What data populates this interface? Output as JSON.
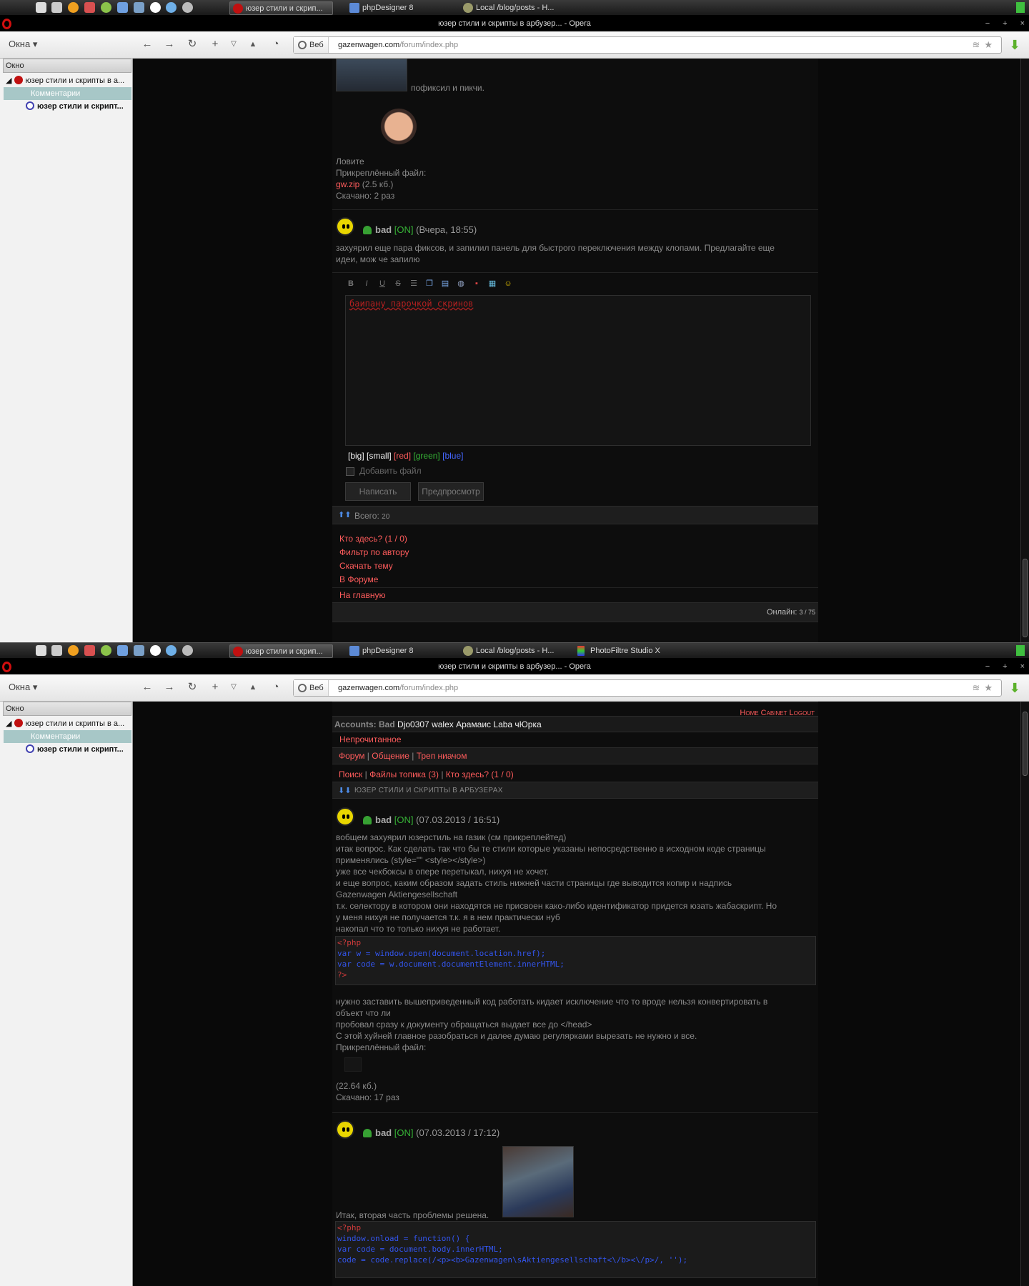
{
  "screen1": {
    "taskbar": {
      "tabs": [
        "юзер стили и скрип...",
        "phpDesigner 8",
        "Local /blog/posts - H..."
      ]
    },
    "window_title": "юзер стили и скрипты в арбузер... - Opera",
    "window_controls": [
      "−",
      "+",
      "×"
    ],
    "okna_label": "Окна",
    "address": {
      "veb_label": "Веб",
      "host": "gazenwagen.com",
      "path": "/forum/index.php"
    },
    "panel": {
      "header": "Окно",
      "items": [
        "юзер стили и скрипты в а...",
        "Комментарии",
        "юзер стили и скрипт..."
      ]
    },
    "post_prev": {
      "text1": "пофиксил и пикчи.",
      "text2": "Ловите",
      "attach_label": "Прикреплённый файл:",
      "file_name": "gw.zip",
      "file_size": "(2.5 кб.)",
      "downloads": "Скачано: 2 раз"
    },
    "post_last": {
      "author": "bad",
      "status": "[ON]",
      "date": "(Вчера, 18:55)",
      "body": [
        "захуярил еще пара фиксов, и запилил панель для быстрого переключения между клопами. Предлагайте еще",
        "идеи, мож че запилю"
      ]
    },
    "editor": {
      "tools": [
        "B",
        "I",
        "U",
        "S",
        "list-icon",
        "copy-icon",
        "image-icon",
        "link-icon",
        "color-icon",
        "table-icon",
        "smile-icon"
      ],
      "text": "баипану парочкой скринов",
      "format": {
        "big": "[big]",
        "small": "[small]",
        "red": "[red]",
        "green": "[green]",
        "blue": "[blue]"
      },
      "attach_checkbox": "Добавить файл",
      "submit": "Написать",
      "preview": "Предпросмотр"
    },
    "total": "Всего:",
    "total_count": "20",
    "links": [
      {
        "label": "Кто здесь?",
        "extra": "(1 / 0)"
      },
      {
        "label": "Фильтр по автору",
        "extra": ""
      },
      {
        "label": "Скачать тему",
        "extra": ""
      },
      {
        "label": "В Форуме",
        "extra": ""
      },
      {
        "label": "На главную",
        "extra": ""
      }
    ],
    "online_label": "Онлайн:",
    "online_count": "3 / 75"
  },
  "screen2": {
    "taskbar": {
      "tabs": [
        "юзер стили и скрип...",
        "phpDesigner 8",
        "Local /blog/posts - H...",
        "PhotoFiltre Studio X"
      ]
    },
    "window_title": "юзер стили и скрипты в арбузер... - Opera",
    "topnav": [
      "Home",
      "Cabinet",
      "Logout"
    ],
    "accounts_label": "Accounts:",
    "accounts_current": "Bad",
    "accounts": "Djo0307 walex Арамаис Laba чЮрка",
    "unread": "Непрочитанное",
    "crumbs": [
      "Форум",
      "Общение",
      "Треп ниачом"
    ],
    "actions": {
      "search": "Поиск",
      "files": "Файлы топика",
      "files_count": "(3)",
      "who": "Кто здесь?",
      "who_count": "(1 / 0)"
    },
    "topic_title": "юзер стили и скрипты в арбузерах",
    "post1": {
      "author": "bad",
      "status": "[ON]",
      "date": "(07.03.2013 / 16:51)",
      "lines": [
        "вобщем захуярил юзерстиль на газик (см прикреплейтед)",
        "итак вопрос. Как сделать так что бы те стили которые указаны непосредственно в исходном коде страницы",
        "применялись (style=\"\" <style></style>)",
        "уже все чекбоксы в опере перетыкал, нихуя не хочет.",
        "и еще вопрос, каким образом задать стиль нижней части страницы где выводится копир и надпись",
        "Gazenwagen Aktiengesellschaft",
        "т.к. селектору в котором они находятся не присвоен како-либо идентификатор придется юзать жабаскрипт. Но",
        "у меня нихуя не получается т.к. я в нем практически нуб",
        "накопал что то только нихуя не работает."
      ],
      "code": [
        "<?php",
        "var w = window.open(document.location.href);",
        "var code = w.document.documentElement.innerHTML;",
        "?>"
      ],
      "after": [
        "нужно заставить вышеприведенный код работать кидает исключение что то вроде нельзя конвертировать в",
        "объект что ли",
        "пробовал сразу к документу обращаться выдает все до </head>",
        "С этой хуйней главное разобраться и далее думаю регулярками вырезать не нужно и все."
      ],
      "attach_label": "Прикреплённый файл:",
      "file_size": "(22.64 кб.)",
      "downloads": "Скачано: 17 раз"
    },
    "post2": {
      "author": "bad",
      "status": "[ON]",
      "date": "(07.03.2013 / 17:12)",
      "text": "Итак, вторая часть проблемы решена.",
      "code": [
        "<?php",
        "window.onload = function() {",
        "var code = document.body.innerHTML;",
        "code = code.replace(/<p><b>Gazenwagen\\sAktiengesellschaft<\\/b><\\/p>/, '');"
      ]
    }
  }
}
